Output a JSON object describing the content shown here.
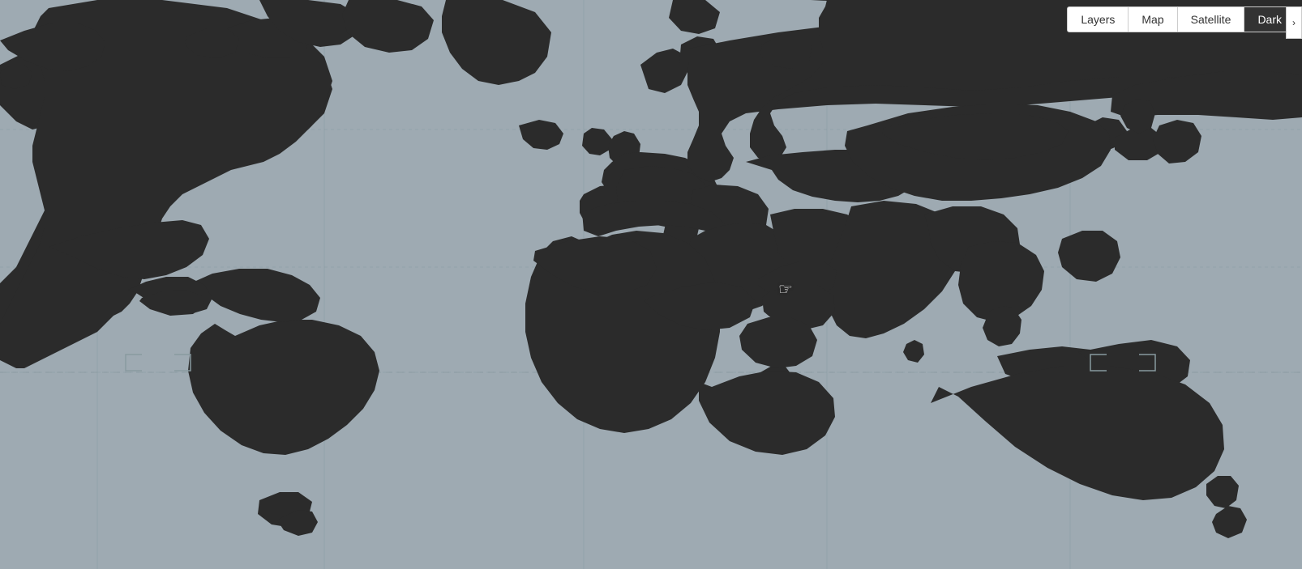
{
  "controls": {
    "layers_label": "Layers",
    "map_label": "Map",
    "satellite_label": "Satellite",
    "dark_label": "Dark",
    "active_view": "dark"
  },
  "map": {
    "background_color": "#9eaab2",
    "land_color": "#2b2b2b",
    "grid_color": "#8899a0"
  }
}
